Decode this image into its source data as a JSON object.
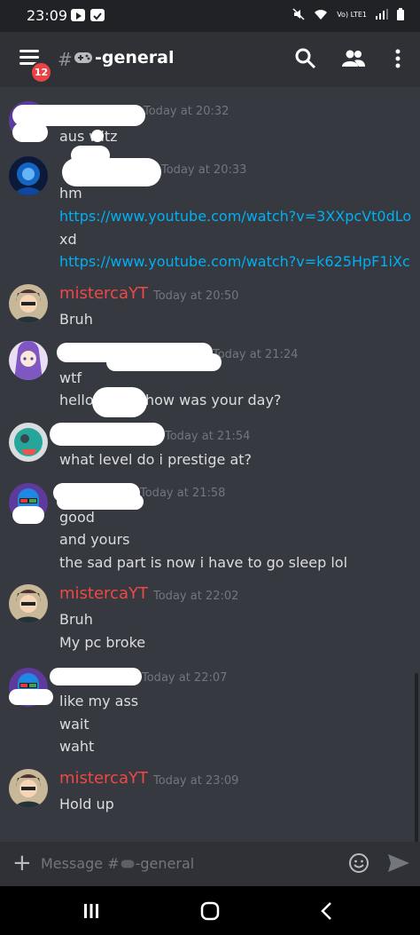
{
  "status_bar": {
    "time": "23:09",
    "network": "Vo) LTE1"
  },
  "header": {
    "badge_count": "12",
    "hash": "#",
    "channel_name": "-general"
  },
  "messages": [
    {
      "author": "",
      "timestamp": "Today at 20:32",
      "lines": [
        "aus  witz"
      ]
    },
    {
      "author": "",
      "timestamp": "Today at 20:33",
      "lines": [
        "hm",
        "https://www.youtube.com/watch?v=3XXpcVt0dLo",
        "xd",
        "https://www.youtube.com/watch?v=k625HpF1iXc"
      ]
    },
    {
      "author": "mistercaYT",
      "timestamp": "Today at 20:50",
      "lines": [
        "Bruh"
      ]
    },
    {
      "author": "",
      "timestamp": "Today at 21:24",
      "lines": [
        "wtf",
        "hello",
        "how was your day?"
      ]
    },
    {
      "author": "",
      "timestamp": "Today at 21:54",
      "lines": [
        "what level do i prestige at?"
      ]
    },
    {
      "author": "",
      "timestamp": "Today at 21:58",
      "lines": [
        "good",
        "and yours",
        "the sad part is now i have to go sleep lol"
      ]
    },
    {
      "author": "mistercaYT",
      "timestamp": "Today at 22:02",
      "lines": [
        "Bruh",
        "My pc broke"
      ]
    },
    {
      "author": "",
      "timestamp": "Today at 22:07",
      "lines": [
        "like my ass",
        "wait",
        "waht"
      ]
    },
    {
      "author": "mistercaYT",
      "timestamp": "Today at 23:09",
      "lines": [
        "Hold up"
      ]
    }
  ],
  "composer": {
    "placeholder": "Message #",
    "channel": "-general"
  },
  "colors": {
    "background": "#36393f",
    "header": "#2f3136",
    "link": "#00b0f4",
    "author_red": "#f04747",
    "badge": "#ed4245"
  },
  "icons": [
    "menu-icon",
    "gamepad-icon",
    "search-icon",
    "members-icon",
    "more-icon",
    "plus-icon",
    "emoji-icon",
    "send-icon",
    "recents-icon",
    "home-icon",
    "back-icon"
  ]
}
